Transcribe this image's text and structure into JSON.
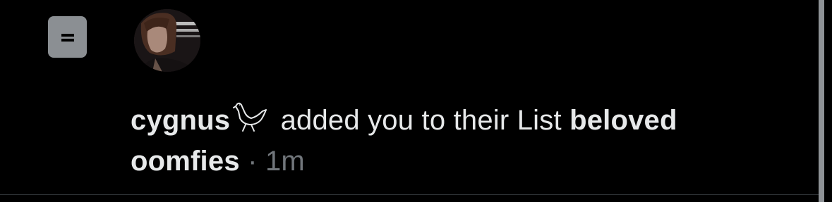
{
  "notification": {
    "username": "cygnus",
    "username_emoji": "swan-icon",
    "action_text": " added you to their List ",
    "list_name": "beloved oomfies",
    "separator": "·",
    "time_ago": "1m",
    "type_icon": "list-icon"
  },
  "colors": {
    "background": "#000000",
    "text": "#e7e9ea",
    "muted": "#71767b",
    "list_icon_bg": "#8b8f93",
    "divider": "#2f3336"
  }
}
